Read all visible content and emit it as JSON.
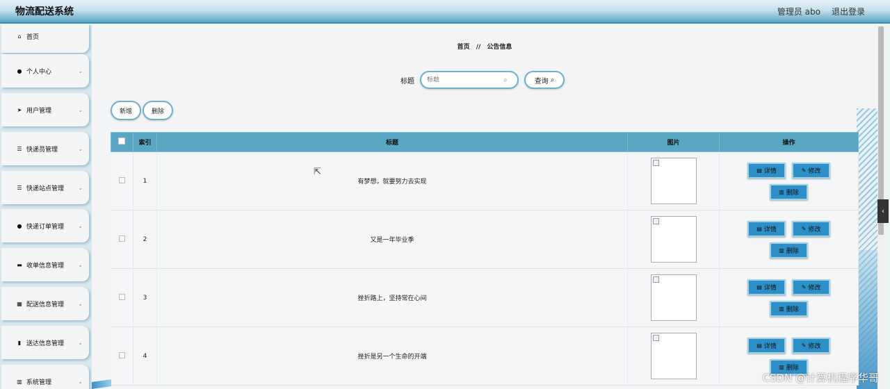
{
  "header": {
    "title": "物流配送系统",
    "user_label": "管理员 abo",
    "logout_label": "退出登录"
  },
  "sidebar": {
    "items": [
      {
        "label": "首页",
        "icon": "home-icon",
        "glyph": "⌂",
        "has_chevron": false
      },
      {
        "label": "个人中心",
        "icon": "person-icon",
        "glyph": "●",
        "has_chevron": true
      },
      {
        "label": "用户管理",
        "icon": "send-icon",
        "glyph": "➤",
        "has_chevron": true
      },
      {
        "label": "快递员管理",
        "icon": "list-icon",
        "glyph": "☰",
        "has_chevron": true
      },
      {
        "label": "快递站点管理",
        "icon": "list-icon",
        "glyph": "☰",
        "has_chevron": true
      },
      {
        "label": "快递订单管理",
        "icon": "person-icon",
        "glyph": "●",
        "has_chevron": true
      },
      {
        "label": "收单信息管理",
        "icon": "monitor-icon",
        "glyph": "▬",
        "has_chevron": true
      },
      {
        "label": "配送信息管理",
        "icon": "grid-icon",
        "glyph": "▦",
        "has_chevron": true
      },
      {
        "label": "送达信息管理",
        "icon": "clipboard-icon",
        "glyph": "▮",
        "has_chevron": true
      },
      {
        "label": "系统管理",
        "icon": "bar-chart-icon",
        "glyph": "▥",
        "has_chevron": true
      }
    ]
  },
  "breadcrumb": {
    "home": "首页",
    "separator": "//",
    "current": "公告信息"
  },
  "search": {
    "label": "标题",
    "placeholder": "标题",
    "button_label": "查询"
  },
  "actions": {
    "add_label": "新增",
    "delete_label": "删除"
  },
  "table": {
    "headers": {
      "index": "索引",
      "title": "标题",
      "image": "图片",
      "ops": "操作"
    },
    "rows": [
      {
        "index": "1",
        "title": "有梦想，就要努力去实现"
      },
      {
        "index": "2",
        "title": "又是一年毕业季"
      },
      {
        "index": "3",
        "title": "挫折路上，坚持常在心间"
      },
      {
        "index": "4",
        "title": "挫折是另一个生命的开端"
      }
    ],
    "op_labels": {
      "detail": "详情",
      "edit": "修改",
      "delete": "删除"
    }
  },
  "watermark": "CSDN @计算机程序华哥",
  "colors": {
    "header_blue": "#3b8db0",
    "table_head": "#5aa6c5",
    "op_button": "#2d8fc7"
  }
}
